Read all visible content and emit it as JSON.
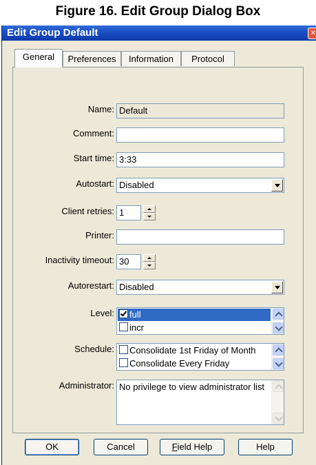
{
  "figure_caption": "Figure 16. Edit Group Dialog Box",
  "window": {
    "title": "Edit Group Default"
  },
  "tabs": [
    {
      "label": "General",
      "active": true
    },
    {
      "label": "Preferences",
      "active": false
    },
    {
      "label": "Information",
      "active": false
    },
    {
      "label": "Protocol",
      "active": false
    }
  ],
  "form": {
    "name": {
      "label": "Name:",
      "value": "Default"
    },
    "comment": {
      "label": "Comment:",
      "value": ""
    },
    "start_time": {
      "label": "Start time:",
      "value": "3:33"
    },
    "autostart": {
      "label": "Autostart:",
      "value": "Disabled"
    },
    "client_retries": {
      "label": "Client retries:",
      "value": "1"
    },
    "printer": {
      "label": "Printer:",
      "value": ""
    },
    "inactivity_timeout": {
      "label": "Inactivity timeout:",
      "value": "30"
    },
    "autorestart": {
      "label": "Autorestart:",
      "value": "Disabled"
    },
    "level": {
      "label": "Level:",
      "items": [
        {
          "text": "full",
          "checked": true,
          "selected": true
        },
        {
          "text": "incr",
          "checked": false,
          "selected": false
        }
      ]
    },
    "schedule": {
      "label": "Schedule:",
      "items": [
        {
          "text": "Consolidate 1st Friday of Month",
          "checked": false
        },
        {
          "text": "Consolidate Every Friday",
          "checked": false
        }
      ]
    },
    "administrator": {
      "label": "Administrator:",
      "value": "No privilege to view administrator list"
    }
  },
  "buttons": {
    "ok": "OK",
    "cancel": "Cancel",
    "field_help_prefix": "F",
    "field_help_rest": "ield Help",
    "help": "Help"
  },
  "icons": {
    "close": "close-icon",
    "dropdown": "chevron-down-icon"
  },
  "colors": {
    "titlebar": "#0d3aa9",
    "dialog_bg": "#ece9d8",
    "selection": "#316ac5"
  }
}
